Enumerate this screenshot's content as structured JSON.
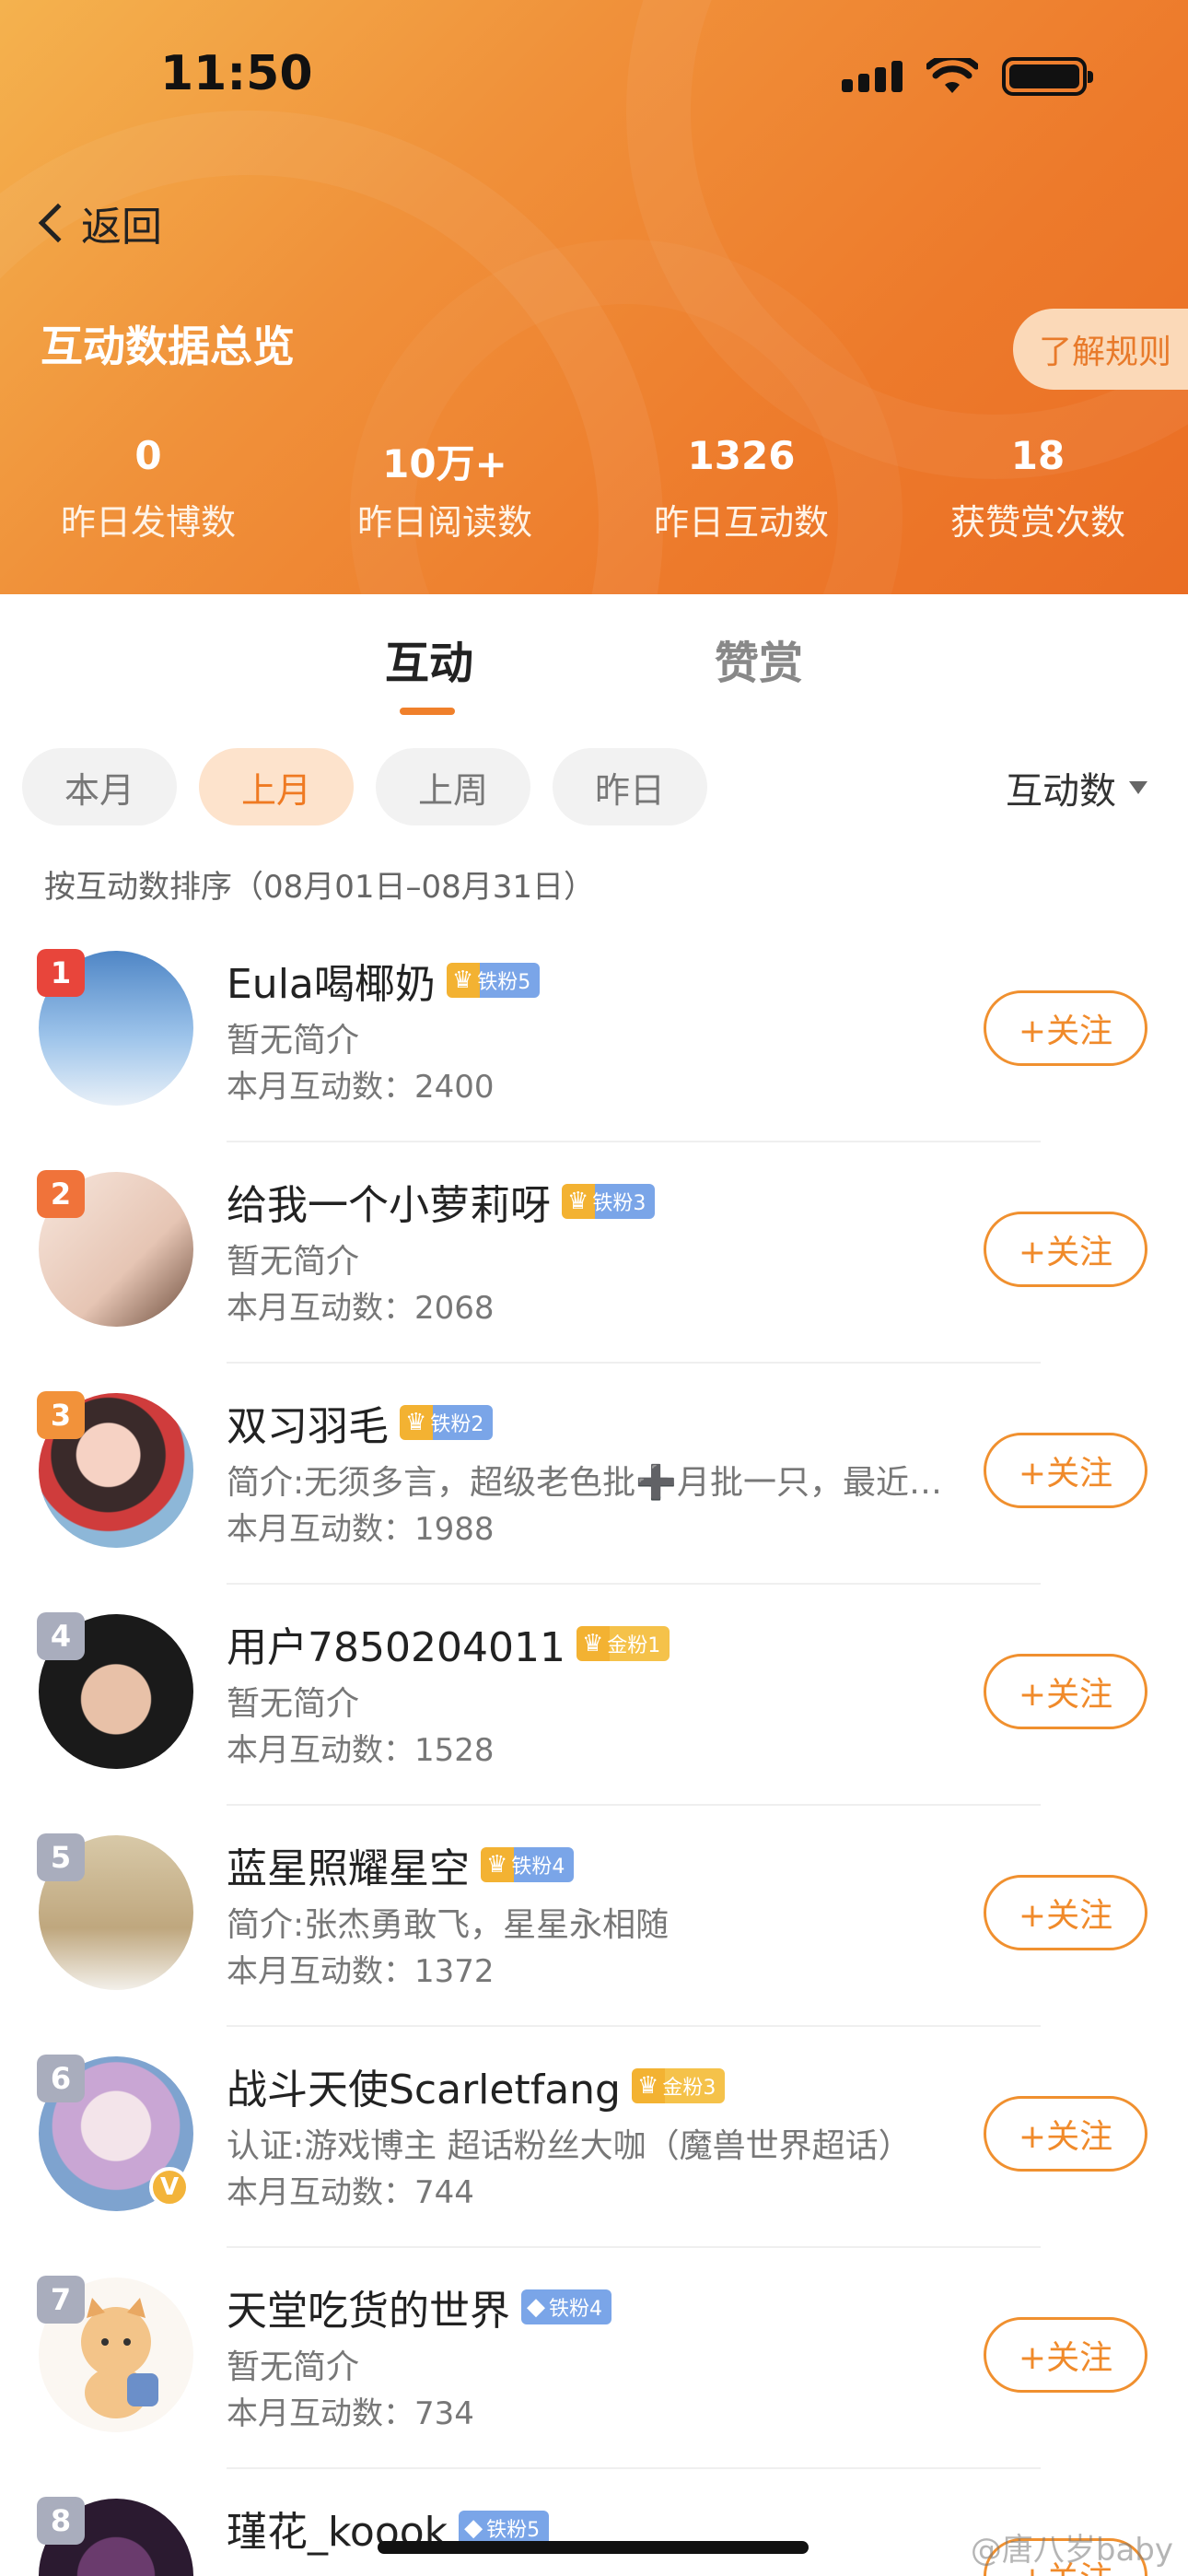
{
  "status_bar": {
    "time": "11:50"
  },
  "header": {
    "back_label": "返回",
    "title": "互动数据总览",
    "rules_button": "了解规则",
    "stats": [
      {
        "value": "0",
        "label": "昨日发博数"
      },
      {
        "value": "10万+",
        "label": "昨日阅读数"
      },
      {
        "value": "1326",
        "label": "昨日互动数"
      },
      {
        "value": "18",
        "label": "获赞赏次数"
      }
    ]
  },
  "tabs": {
    "active": "互动",
    "inactive": "赞赏"
  },
  "filters": {
    "chips": [
      "本月",
      "上月",
      "上周",
      "昨日"
    ],
    "active_chip": "上月",
    "sort_label": "互动数"
  },
  "sort_note": "按互动数排序（08月01日–08月31日）",
  "follow_label": "+关注",
  "users": [
    {
      "rank": "1",
      "name": "Eula喝椰奶",
      "badge": "铁粉5",
      "badge_type": "iron",
      "bio": "暂无简介",
      "count": "本月互动数：2400"
    },
    {
      "rank": "2",
      "name": "给我一个小萝莉呀",
      "badge": "铁粉3",
      "badge_type": "iron",
      "bio": "暂无简介",
      "count": "本月互动数：2068"
    },
    {
      "rank": "3",
      "name": "双习羽毛",
      "badge": "铁粉2",
      "badge_type": "iron",
      "bio": "简介:无须多言，超级老色批➕月批一只，最近…",
      "count": "本月互动数：1988"
    },
    {
      "rank": "4",
      "name": "用户7850204011",
      "badge": "金粉1",
      "badge_type": "gold",
      "bio": "暂无简介",
      "count": "本月互动数：1528"
    },
    {
      "rank": "5",
      "name": "蓝星照耀星空",
      "badge": "铁粉4",
      "badge_type": "iron",
      "bio": "简介:张杰勇敢飞，星星永相随",
      "count": "本月互动数：1372"
    },
    {
      "rank": "6",
      "name": "战斗天使Scarletfang",
      "badge": "金粉3",
      "badge_type": "gold",
      "bio": "认证:游戏博主 超话粉丝大咖（魔兽世界超话）",
      "count": "本月互动数：744"
    },
    {
      "rank": "7",
      "name": "天堂吃货的世界",
      "badge": "铁粉4",
      "badge_type": "diamond",
      "bio": "暂无简介",
      "count": "本月互动数：734"
    },
    {
      "rank": "8",
      "name": "瑾花_koook",
      "badge": "铁粉5",
      "badge_type": "diamond",
      "bio": "",
      "count": ""
    }
  ],
  "watermark": "@唐八岁baby"
}
